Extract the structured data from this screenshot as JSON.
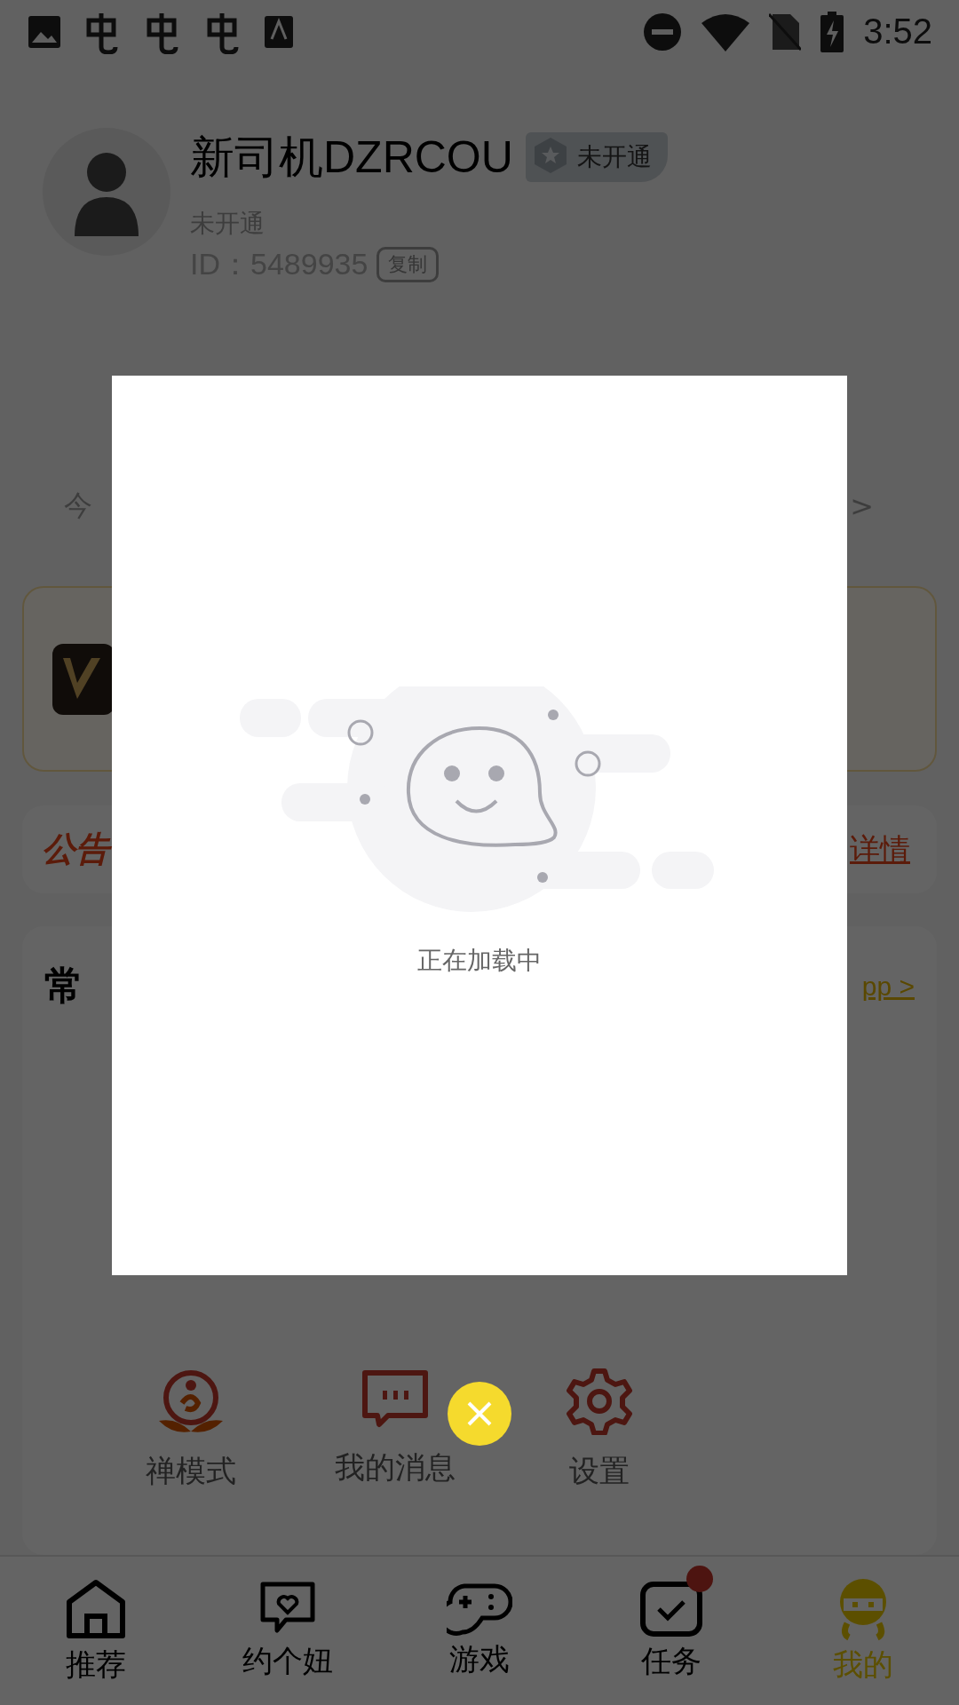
{
  "status_bar": {
    "time": "3:52"
  },
  "profile": {
    "name": "新司机DZRCOU",
    "badge": "未开通",
    "status": "未开通",
    "id": "ID：5489935",
    "copy_button": "复制"
  },
  "today_row": {
    "left": "今",
    "right": ">"
  },
  "notice": {
    "label": "公告",
    "link": "详情"
  },
  "tools": {
    "title": "常",
    "link": "pp >",
    "items": [
      {
        "label": "禅模式",
        "kind": "zen"
      },
      {
        "label": "我的消息",
        "kind": "message"
      },
      {
        "label": "设置",
        "kind": "settings"
      }
    ]
  },
  "loading_dialog": {
    "message": "正在加载中"
  },
  "tabs": [
    {
      "label": "推荐",
      "kind": "home",
      "selected": false,
      "dot": false
    },
    {
      "label": "约个妞",
      "kind": "chat",
      "selected": false,
      "dot": false
    },
    {
      "label": "游戏",
      "kind": "game",
      "selected": false,
      "dot": false
    },
    {
      "label": "任务",
      "kind": "task",
      "selected": false,
      "dot": true
    },
    {
      "label": "我的",
      "kind": "me",
      "selected": true,
      "dot": false
    }
  ]
}
